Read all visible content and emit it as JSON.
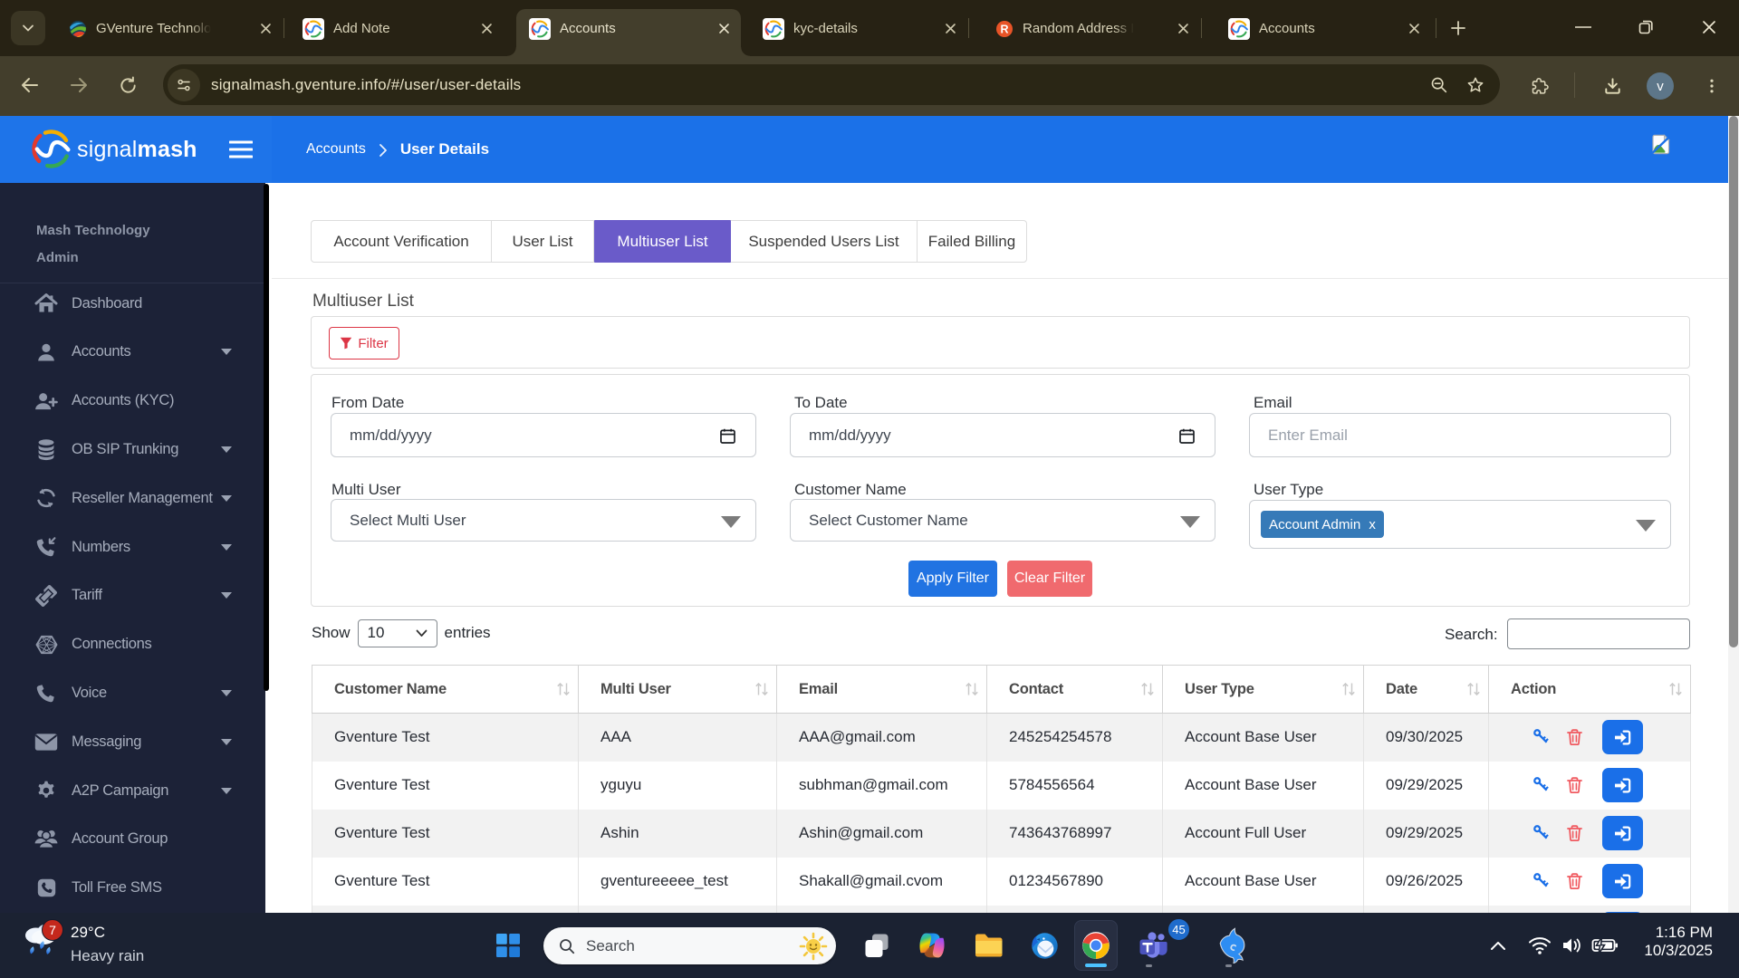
{
  "browser": {
    "tab_search_tooltip": "tab-search",
    "tabs": [
      {
        "title": "GVenture Technolo",
        "favicon": "gventure",
        "active": false
      },
      {
        "title": "Add Note",
        "favicon": "signalmash",
        "active": false
      },
      {
        "title": "Accounts",
        "favicon": "signalmash",
        "active": true
      },
      {
        "title": "kyc-details",
        "favicon": "signalmash",
        "active": false
      },
      {
        "title": "Random Address I",
        "favicon": "r",
        "active": false
      },
      {
        "title": "Accounts",
        "favicon": "signalmash",
        "active": false
      }
    ],
    "url": "signalmash.gventure.info/#/user/user-details",
    "profile_initial": "v"
  },
  "app": {
    "brand": {
      "first": "signal",
      "second": "mash"
    },
    "breadcrumb": {
      "section": "Accounts",
      "separator": "›",
      "page": "User Details"
    },
    "sidebar": {
      "org_line1": "Mash Technology",
      "org_line2": "Admin",
      "items": [
        {
          "label": "Dashboard",
          "icon": "home",
          "caret": false
        },
        {
          "label": "Accounts",
          "icon": "user",
          "caret": true
        },
        {
          "label": "Accounts (KYC)",
          "icon": "user-plus",
          "caret": false
        },
        {
          "label": "OB SIP Trunking",
          "icon": "database",
          "caret": true
        },
        {
          "label": "Reseller Management",
          "icon": "sync",
          "caret": true
        },
        {
          "label": "Numbers",
          "icon": "phone-incoming",
          "caret": true
        },
        {
          "label": "Tariff",
          "icon": "ticket",
          "caret": true
        },
        {
          "label": "Connections",
          "icon": "hexweb",
          "caret": false
        },
        {
          "label": "Voice",
          "icon": "phone",
          "caret": true
        },
        {
          "label": "Messaging",
          "icon": "envelope",
          "caret": true
        },
        {
          "label": "A2P Campaign",
          "icon": "gear",
          "caret": true
        },
        {
          "label": "Account Group",
          "icon": "users",
          "caret": false
        },
        {
          "label": "Toll Free SMS",
          "icon": "phone-square",
          "caret": false
        }
      ]
    },
    "tabs": [
      {
        "label": "Account Verification",
        "active": false
      },
      {
        "label": "User List",
        "active": false
      },
      {
        "label": "Multiuser List",
        "active": true
      },
      {
        "label": "Suspended Users List",
        "active": false
      },
      {
        "label": "Failed Billing",
        "active": false
      }
    ],
    "heading": "Multiuser List",
    "filter": {
      "button": "Filter",
      "from_date_label": "From Date",
      "to_date_label": "To Date",
      "email_label": "Email",
      "date_placeholder": "mm/dd/yyyy",
      "email_placeholder": "Enter Email",
      "multi_user_label": "Multi User",
      "customer_name_label": "Customer Name",
      "user_type_label": "User Type",
      "multi_user_placeholder": "Select Multi User",
      "customer_name_placeholder": "Select Customer Name",
      "user_type_chip": "Account Admin",
      "user_type_chip_remove": "x",
      "apply": "Apply Filter",
      "clear": "Clear Filter"
    },
    "entries": {
      "show": "Show",
      "page_size": "10",
      "entries": "entries",
      "search_label": "Search:"
    },
    "table": {
      "columns": [
        "Customer Name",
        "Multi User",
        "Email",
        "Contact",
        "User Type",
        "Date",
        "Action"
      ],
      "sort_glyph": "↑↓",
      "rows": [
        {
          "customer": "Gventure Test",
          "multiuser": "AAA",
          "email": "AAA@gmail.com",
          "contact": "245254254578",
          "usertype": "Account Base User",
          "date": "09/30/2025"
        },
        {
          "customer": "Gventure Test",
          "multiuser": "yguyu",
          "email": "subhman@gmail.com",
          "contact": "5784556564",
          "usertype": "Account Base User",
          "date": "09/29/2025"
        },
        {
          "customer": "Gventure Test",
          "multiuser": "Ashin",
          "email": "Ashin@gmail.com",
          "contact": "743643768997",
          "usertype": "Account Full User",
          "date": "09/29/2025"
        },
        {
          "customer": "Gventure Test",
          "multiuser": "gventureeeee_test",
          "email": "Shakall@gmail.cvom",
          "contact": "01234567890",
          "usertype": "Account Base User",
          "date": "09/26/2025"
        }
      ]
    }
  },
  "taskbar": {
    "weather_temp": "29°C",
    "weather_desc": "Heavy rain",
    "weather_badge": "7",
    "search_placeholder": "Search",
    "teams_badge": "45",
    "clock_time": "1:16 PM",
    "clock_date": "10/3/2025"
  }
}
